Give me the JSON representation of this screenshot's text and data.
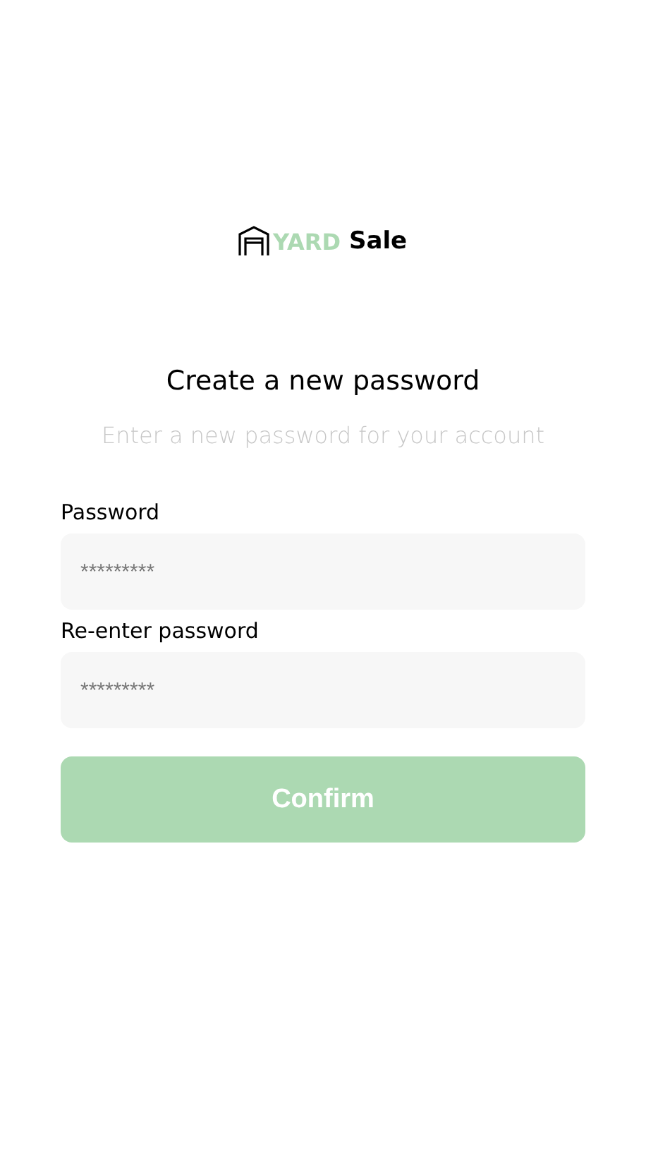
{
  "logo": {
    "accent": "YARD",
    "text": "Sale"
  },
  "title": "Create a new password",
  "subtitle": "Enter a new password for your account",
  "fields": [
    {
      "label": "Password",
      "placeholder": "*********"
    },
    {
      "label": "Re-enter password",
      "placeholder": "*********"
    }
  ],
  "button": {
    "label": "Confirm",
    "disabled": true
  }
}
